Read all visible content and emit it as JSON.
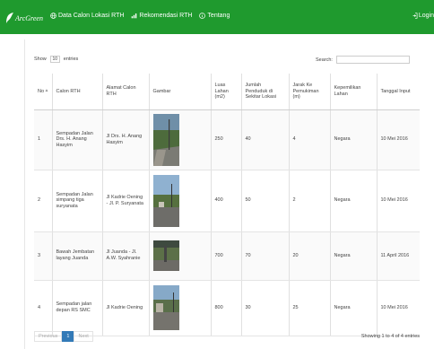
{
  "nav": {
    "brand": "ArcGreen",
    "items": [
      {
        "label": "Data Calon Lokasi RTH",
        "icon": "globe-icon"
      },
      {
        "label": "Rekomendasi RTH",
        "icon": "chart-icon"
      },
      {
        "label": "Tentang",
        "icon": "info-icon"
      }
    ],
    "login": "Login",
    "login_icon": "login-icon"
  },
  "table_controls": {
    "show_label": "Show",
    "entries_value": "10",
    "entries_label": "entries",
    "search_label": "Search:",
    "search_value": ""
  },
  "table": {
    "columns": [
      "No",
      "Calon RTH",
      "Alamat Calon RTH",
      "Gambar",
      "Luas Lahan (m2)",
      "Jumlah Penduduk di Sekitar Lokasi",
      "Jarak Ke Pemukiman (m)",
      "Kepemilikan Lahan",
      "Tanggal Input"
    ],
    "rows": [
      {
        "no": "1",
        "calon": "Sempadan Jalan Drs. H. Anang Hasyim",
        "alamat": "Jl Drs. H. Anang Hasyim",
        "luas": "250",
        "jumlah": "40",
        "jarak": "4",
        "kepemilikan": "Negara",
        "tanggal": "10 Mei 2016"
      },
      {
        "no": "2",
        "calon": "Sempadan Jalan simpang tiga suryanata",
        "alamat": "Jl Kadrie Oening - Jl. P. Suryanata",
        "luas": "400",
        "jumlah": "50",
        "jarak": "2",
        "kepemilikan": "Negara",
        "tanggal": "10 Mei 2016"
      },
      {
        "no": "3",
        "calon": "Bawah Jembatan layang Juanda",
        "alamat": "Jl Juanda - Jl. A.W. Syahranie",
        "luas": "700",
        "jumlah": "70",
        "jarak": "20",
        "kepemilikan": "Negara",
        "tanggal": "11 April 2016"
      },
      {
        "no": "4",
        "calon": "Sempadan jalan depan RS SMC",
        "alamat": "Jl Kadrie Oening",
        "luas": "800",
        "jumlah": "30",
        "jarak": "25",
        "kepemilikan": "Negara",
        "tanggal": "10 Mei 2016"
      }
    ]
  },
  "pagination": {
    "previous": "Previous",
    "current": "1",
    "next": "Next",
    "info": "Showing 1 to 4 of 4 entries"
  },
  "colors": {
    "navbar": "#1f9a2e",
    "page_active": "#337ab7"
  }
}
